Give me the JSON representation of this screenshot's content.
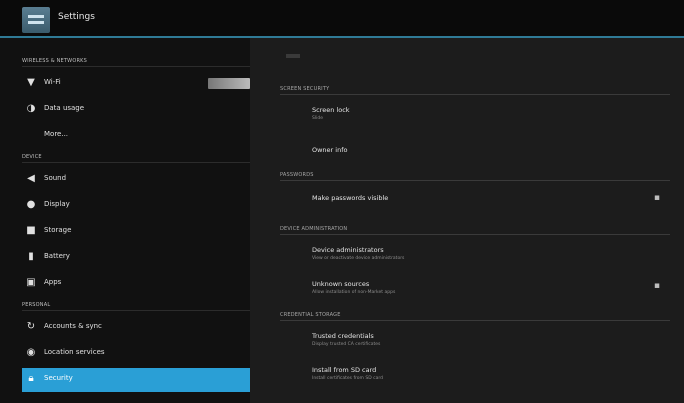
{
  "titlebar": {
    "title": "Settings"
  },
  "sidebar": {
    "sections": [
      {
        "label": "Wireless & networks"
      },
      {
        "label": "Device"
      },
      {
        "label": "Personal"
      }
    ],
    "items": [
      {
        "label": "Wi-Fi",
        "icon": "wifi-icon"
      },
      {
        "label": "Data usage",
        "icon": "data-usage-icon"
      },
      {
        "label": "More..."
      },
      {
        "label": "Sound",
        "icon": "sound-icon"
      },
      {
        "label": "Display",
        "icon": "display-icon"
      },
      {
        "label": "Storage",
        "icon": "storage-icon"
      },
      {
        "label": "Battery",
        "icon": "battery-icon"
      },
      {
        "label": "Apps",
        "icon": "apps-icon"
      },
      {
        "label": "Accounts & sync",
        "icon": "sync-icon"
      },
      {
        "label": "Location services",
        "icon": "location-icon"
      },
      {
        "label": "Security",
        "icon": "lock-icon"
      }
    ]
  },
  "main": {
    "sections": [
      {
        "label": "Screen security"
      },
      {
        "label": "Passwords"
      },
      {
        "label": "Device administration"
      },
      {
        "label": "Credential storage"
      }
    ],
    "rows": [
      {
        "title": "Screen lock",
        "subtitle": "Slide"
      },
      {
        "title": "Owner info"
      },
      {
        "title": "Make passwords visible"
      },
      {
        "title": "Device administrators",
        "subtitle": "View or deactivate device administrators"
      },
      {
        "title": "Unknown sources",
        "subtitle": "Allow installation of non-Market apps"
      },
      {
        "title": "Trusted credentials",
        "subtitle": "Display trusted CA certificates"
      },
      {
        "title": "Install from SD card",
        "subtitle": "Install certificates from SD card"
      }
    ]
  }
}
